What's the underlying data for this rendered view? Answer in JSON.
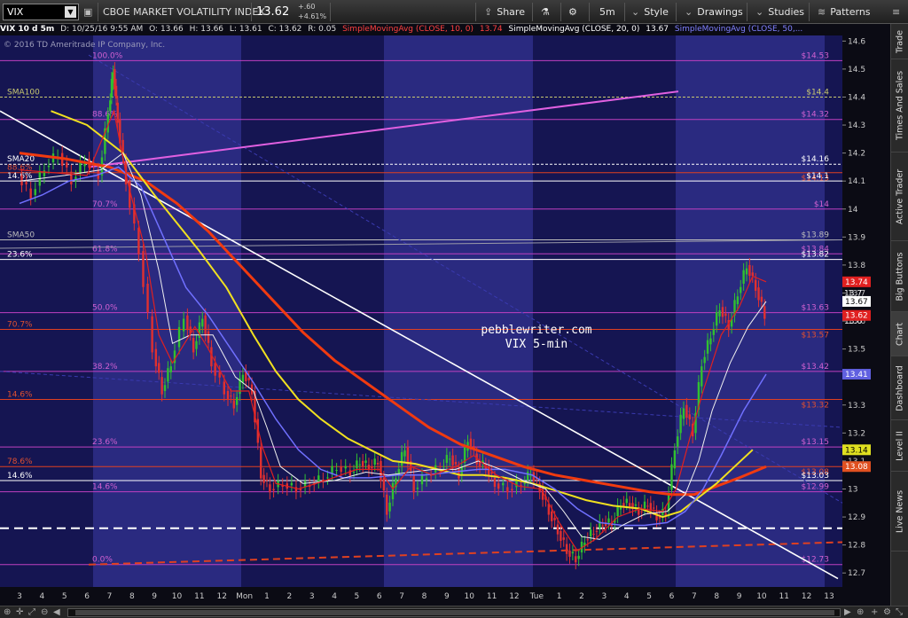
{
  "toolbar": {
    "symbol": "VIX",
    "description": "CBOE MARKET VOLATILITY INDEX",
    "last_price": "13.62",
    "net_change": "+.60",
    "pct_change": "+4.61%",
    "share_label": "Share",
    "timeframe_label": "5m",
    "style_label": "Style",
    "drawings_label": "Drawings",
    "studies_label": "Studies",
    "patterns_label": "Patterns"
  },
  "status": {
    "symbol_period": "VIX 10 d 5m",
    "date": "D: 10/25/16 9:55 AM",
    "open": "O: 13.66",
    "high": "H: 13.66",
    "low": "L: 13.61",
    "close": "C: 13.62",
    "range": "R: 0.05",
    "sma10_label": "SimpleMovingAvg (CLOSE, 10, 0)",
    "sma10_value": "13.74",
    "sma20_label": "SimpleMovingAvg (CLOSE, 20, 0)",
    "sma20_value": "13.67",
    "sma50_label": "SimpleMovingAvg (CLOSE, 50,..."
  },
  "chart_data": {
    "type": "candlestick",
    "copyright": "© 2016 TD Ameritrade IP Company, Inc.",
    "annotation_lines": [
      "pebblewriter.com",
      "VIX 5-min"
    ],
    "y_axis": {
      "min": 12.65,
      "max": 14.62,
      "ticks": [
        12.7,
        12.8,
        12.9,
        13,
        13.1,
        13.2,
        13.3,
        13.4,
        13.5,
        13.6,
        13.7,
        13.8,
        13.9,
        14,
        14.1,
        14.2,
        14.3,
        14.4,
        14.5,
        14.6
      ]
    },
    "x_axis_labels": [
      "3",
      "4",
      "5",
      "6",
      "7",
      "8",
      "9",
      "10",
      "11",
      "12",
      "Mon",
      "1",
      "2",
      "3",
      "4",
      "5",
      "6",
      "7",
      "8",
      "9",
      "10",
      "11",
      "12",
      "Tue",
      "1",
      "2",
      "3",
      "4",
      "5",
      "6",
      "7",
      "8",
      "9",
      "10",
      "11",
      "12",
      "13"
    ],
    "session_shading": [
      "night",
      "day",
      "night",
      "day",
      "night",
      "day",
      "night"
    ],
    "fib_levels_left": [
      {
        "label": "100.0%",
        "price": 14.53,
        "right_label": "$14.53",
        "color": "#c040c0"
      },
      {
        "label": "88.6%",
        "price": 14.32,
        "right_label": "$14.32",
        "color": "#c040c0"
      },
      {
        "label": "70.7%",
        "price": 14.0,
        "right_label": "$14",
        "color": "#c040c0"
      },
      {
        "label": "61.8%",
        "price": 13.84,
        "right_label": "$13.84",
        "color": "#c040c0"
      },
      {
        "label": "50.0%",
        "price": 13.63,
        "right_label": "$13.63",
        "color": "#c040c0"
      },
      {
        "label": "38.2%",
        "price": 13.42,
        "right_label": "$13.42",
        "color": "#c040c0"
      },
      {
        "label": "23.6%",
        "price": 13.15,
        "right_label": "$13.15",
        "color": "#c040c0"
      },
      {
        "label": "14.6%",
        "price": 12.99,
        "right_label": "$12.99",
        "color": "#c040c0"
      },
      {
        "label": "0.0%",
        "price": 12.73,
        "right_label": "$12.73",
        "color": "#c040c0"
      }
    ],
    "fib_levels_red": [
      {
        "label": "88.6%",
        "price": 14.13,
        "right_label": "$14.13"
      },
      {
        "label": "70.7%",
        "price": 13.57,
        "right_label": "$13.57"
      },
      {
        "label": "14.6%",
        "price": 13.32,
        "right_label": "$13.32"
      },
      {
        "label": "78.6%",
        "price": 13.08,
        "right_label": "$13.08"
      }
    ],
    "white_levels": [
      {
        "label": "SMA100",
        "price": 14.4,
        "right_label": "$14.4",
        "color": "#c8c870"
      },
      {
        "label": "SMA20",
        "price": 14.16,
        "right_label": "$14.16",
        "color": "#ffffff"
      },
      {
        "label": "14.6%",
        "price": 14.1,
        "right_label": "$14.1",
        "color": "#ffffff"
      },
      {
        "label": "SMA50",
        "price": 13.89,
        "right_label": "$13.89",
        "color": "#bbbbbb"
      },
      {
        "label": "23.6%",
        "price": 13.82,
        "right_label": "$13.82",
        "color": "#ffffff"
      },
      {
        "label": "14.6%",
        "price": 13.03,
        "right_label": "$13.03",
        "color": "#ffffff"
      }
    ],
    "price_tags": [
      {
        "value": "13.74",
        "color": "#e02020"
      },
      {
        "value": "13.67",
        "color": "#ffffff"
      },
      {
        "value": "13.62",
        "color": "#e02020"
      },
      {
        "value": "13.41",
        "color": "#6060e0"
      },
      {
        "value": "13.14",
        "color": "#e0e020"
      },
      {
        "value": "13.08",
        "color": "#e05020"
      }
    ],
    "axis_side_labels": [
      "13.7",
      "13.6"
    ],
    "series": [
      {
        "name": "SimpleMovingAvg (CLOSE, 10, 0)",
        "color": "#e02020"
      },
      {
        "name": "SimpleMovingAvg (CLOSE, 20, 0)",
        "color": "#f0f0f0"
      },
      {
        "name": "SimpleMovingAvg (CLOSE, 50,...",
        "color": "#7070ff"
      }
    ],
    "close_path": [
      [
        0,
        14.12
      ],
      [
        0.6,
        14.05
      ],
      [
        1.2,
        14.15
      ],
      [
        1.8,
        14.2
      ],
      [
        2.4,
        14.1
      ],
      [
        3.0,
        14.18
      ],
      [
        3.6,
        14.12
      ],
      [
        4.0,
        14.35
      ],
      [
        4.2,
        14.5
      ],
      [
        4.4,
        14.32
      ],
      [
        4.8,
        14.1
      ],
      [
        5.4,
        13.85
      ],
      [
        6.0,
        13.5
      ],
      [
        6.4,
        13.35
      ],
      [
        6.8,
        13.45
      ],
      [
        7.4,
        13.62
      ],
      [
        7.8,
        13.5
      ],
      [
        8.2,
        13.62
      ],
      [
        8.6,
        13.45
      ],
      [
        9.2,
        13.35
      ],
      [
        9.6,
        13.3
      ],
      [
        10.0,
        13.42
      ],
      [
        10.4,
        13.35
      ],
      [
        10.8,
        13.05
      ],
      [
        11.2,
        13.0
      ],
      [
        11.8,
        13.02
      ],
      [
        12.4,
        13.0
      ],
      [
        13.0,
        13.02
      ],
      [
        13.6,
        13.04
      ],
      [
        14.2,
        13.08
      ],
      [
        14.8,
        13.06
      ],
      [
        15.2,
        13.1
      ],
      [
        15.6,
        13.08
      ],
      [
        16.0,
        13.1
      ],
      [
        16.4,
        12.92
      ],
      [
        16.8,
        13.05
      ],
      [
        17.2,
        13.15
      ],
      [
        17.6,
        13.0
      ],
      [
        18.2,
        13.05
      ],
      [
        18.8,
        13.08
      ],
      [
        19.2,
        13.12
      ],
      [
        19.6,
        13.05
      ],
      [
        20.0,
        13.18
      ],
      [
        20.4,
        13.1
      ],
      [
        20.8,
        13.08
      ],
      [
        21.2,
        13.02
      ],
      [
        21.8,
        13.0
      ],
      [
        22.4,
        13.02
      ],
      [
        22.8,
        13.06
      ],
      [
        23.2,
        13.0
      ],
      [
        23.6,
        12.92
      ],
      [
        24.0,
        12.85
      ],
      [
        24.4,
        12.78
      ],
      [
        24.8,
        12.75
      ],
      [
        25.2,
        12.82
      ],
      [
        25.6,
        12.85
      ],
      [
        26.0,
        12.88
      ],
      [
        26.4,
        12.88
      ],
      [
        26.8,
        12.95
      ],
      [
        27.2,
        12.95
      ],
      [
        27.6,
        12.92
      ],
      [
        28.0,
        12.95
      ],
      [
        28.4,
        12.9
      ],
      [
        28.8,
        12.92
      ],
      [
        29.2,
        13.15
      ],
      [
        29.6,
        13.3
      ],
      [
        30.0,
        13.2
      ],
      [
        30.4,
        13.45
      ],
      [
        30.8,
        13.55
      ],
      [
        31.2,
        13.65
      ],
      [
        31.6,
        13.58
      ],
      [
        32.0,
        13.7
      ],
      [
        32.4,
        13.8
      ],
      [
        32.8,
        13.72
      ],
      [
        33.2,
        13.62
      ]
    ],
    "sma10_path": [
      [
        0,
        14.14
      ],
      [
        1.5,
        14.13
      ],
      [
        3,
        14.12
      ],
      [
        4.2,
        14.35
      ],
      [
        4.8,
        14.1
      ],
      [
        5.6,
        13.85
      ],
      [
        6.2,
        13.55
      ],
      [
        6.8,
        13.45
      ],
      [
        7.8,
        13.58
      ],
      [
        8.4,
        13.5
      ],
      [
        9.4,
        13.35
      ],
      [
        10.2,
        13.35
      ],
      [
        10.8,
        13.15
      ],
      [
        11.4,
        13.02
      ],
      [
        12.4,
        13.0
      ],
      [
        13.6,
        13.03
      ],
      [
        15.0,
        13.07
      ],
      [
        16.0,
        13.07
      ],
      [
        16.6,
        13.0
      ],
      [
        17.4,
        13.08
      ],
      [
        18.4,
        13.05
      ],
      [
        19.4,
        13.08
      ],
      [
        20.2,
        13.12
      ],
      [
        21.2,
        13.05
      ],
      [
        22.2,
        13.01
      ],
      [
        23.2,
        13.0
      ],
      [
        24.0,
        12.88
      ],
      [
        24.8,
        12.78
      ],
      [
        25.6,
        12.82
      ],
      [
        26.6,
        12.9
      ],
      [
        27.6,
        12.93
      ],
      [
        28.6,
        12.92
      ],
      [
        29.2,
        13.0
      ],
      [
        29.8,
        13.18
      ],
      [
        30.4,
        13.35
      ],
      [
        31.2,
        13.55
      ],
      [
        32.0,
        13.65
      ],
      [
        32.6,
        13.76
      ],
      [
        33.2,
        13.74
      ]
    ],
    "sma20_path": [
      [
        0,
        14.1
      ],
      [
        2,
        14.12
      ],
      [
        3.6,
        14.14
      ],
      [
        4.6,
        14.2
      ],
      [
        5.4,
        14.05
      ],
      [
        6.2,
        13.78
      ],
      [
        6.8,
        13.52
      ],
      [
        7.6,
        13.55
      ],
      [
        8.6,
        13.55
      ],
      [
        9.6,
        13.4
      ],
      [
        10.4,
        13.35
      ],
      [
        11.0,
        13.22
      ],
      [
        11.6,
        13.08
      ],
      [
        12.6,
        13.02
      ],
      [
        14.0,
        13.03
      ],
      [
        15.4,
        13.06
      ],
      [
        16.4,
        13.05
      ],
      [
        17.4,
        13.06
      ],
      [
        18.4,
        13.07
      ],
      [
        19.4,
        13.07
      ],
      [
        20.4,
        13.1
      ],
      [
        21.4,
        13.07
      ],
      [
        22.4,
        13.03
      ],
      [
        23.4,
        13.0
      ],
      [
        24.2,
        12.92
      ],
      [
        25.0,
        12.83
      ],
      [
        25.8,
        12.82
      ],
      [
        26.8,
        12.87
      ],
      [
        27.8,
        12.91
      ],
      [
        28.8,
        12.92
      ],
      [
        29.6,
        12.98
      ],
      [
        30.2,
        13.1
      ],
      [
        30.8,
        13.28
      ],
      [
        31.6,
        13.45
      ],
      [
        32.4,
        13.58
      ],
      [
        33.2,
        13.67
      ]
    ],
    "sma50_path": [
      [
        0,
        14.02
      ],
      [
        1,
        14.05
      ],
      [
        2.2,
        14.1
      ],
      [
        3.4,
        14.12
      ],
      [
        4.4,
        14.15
      ],
      [
        5.4,
        14.08
      ],
      [
        6.4,
        13.9
      ],
      [
        7.4,
        13.72
      ],
      [
        8.4,
        13.62
      ],
      [
        9.4,
        13.5
      ],
      [
        10.4,
        13.38
      ],
      [
        11.4,
        13.25
      ],
      [
        12.4,
        13.14
      ],
      [
        13.4,
        13.07
      ],
      [
        14.4,
        13.04
      ],
      [
        15.6,
        13.04
      ],
      [
        16.8,
        13.05
      ],
      [
        18.0,
        13.05
      ],
      [
        19.2,
        13.06
      ],
      [
        20.4,
        13.07
      ],
      [
        21.6,
        13.07
      ],
      [
        22.8,
        13.05
      ],
      [
        23.8,
        13.0
      ],
      [
        24.8,
        12.93
      ],
      [
        25.8,
        12.88
      ],
      [
        26.8,
        12.87
      ],
      [
        27.8,
        12.87
      ],
      [
        28.8,
        12.88
      ],
      [
        29.6,
        12.92
      ],
      [
        30.4,
        13.0
      ],
      [
        31.2,
        13.12
      ],
      [
        32.2,
        13.28
      ],
      [
        33.2,
        13.41
      ]
    ],
    "sma_yellow_path": [
      [
        1.4,
        14.35
      ],
      [
        3,
        14.3
      ],
      [
        4.6,
        14.2
      ],
      [
        6.0,
        14.05
      ],
      [
        7.0,
        13.95
      ],
      [
        8.0,
        13.85
      ],
      [
        9.2,
        13.72
      ],
      [
        10.4,
        13.55
      ],
      [
        11.4,
        13.42
      ],
      [
        12.4,
        13.32
      ],
      [
        13.4,
        13.25
      ],
      [
        14.6,
        13.18
      ],
      [
        15.6,
        13.14
      ],
      [
        16.6,
        13.1
      ],
      [
        17.6,
        13.09
      ],
      [
        18.6,
        13.07
      ],
      [
        19.6,
        13.05
      ],
      [
        20.6,
        13.05
      ],
      [
        21.6,
        13.04
      ],
      [
        22.8,
        13.02
      ],
      [
        24.0,
        12.99
      ],
      [
        25.2,
        12.96
      ],
      [
        26.4,
        12.94
      ],
      [
        27.6,
        12.93
      ],
      [
        28.6,
        12.9
      ],
      [
        29.4,
        12.92
      ],
      [
        30.2,
        12.97
      ],
      [
        31.0,
        13.02
      ],
      [
        31.8,
        13.08
      ],
      [
        32.6,
        13.14
      ]
    ],
    "sma_orange_path": [
      [
        0,
        14.2
      ],
      [
        2,
        14.18
      ],
      [
        4,
        14.15
      ],
      [
        5.6,
        14.1
      ],
      [
        7.0,
        14.02
      ],
      [
        8.4,
        13.92
      ],
      [
        9.8,
        13.8
      ],
      [
        11.2,
        13.68
      ],
      [
        12.6,
        13.56
      ],
      [
        14.0,
        13.46
      ],
      [
        15.4,
        13.38
      ],
      [
        16.8,
        13.3
      ],
      [
        18.2,
        13.22
      ],
      [
        19.6,
        13.16
      ],
      [
        21.0,
        13.12
      ],
      [
        22.4,
        13.08
      ],
      [
        23.8,
        13.05
      ],
      [
        25.2,
        13.03
      ],
      [
        26.6,
        13.01
      ],
      [
        28.0,
        12.99
      ],
      [
        29.0,
        12.98
      ],
      [
        30.0,
        12.98
      ],
      [
        31.0,
        13.01
      ],
      [
        32.0,
        13.04
      ],
      [
        33.2,
        13.08
      ]
    ]
  },
  "side_tabs": [
    "Trade",
    "Times And Sales",
    "Active Trader",
    "Big Buttons",
    "Chart",
    "Dashboard",
    "Level II",
    "Live News"
  ]
}
